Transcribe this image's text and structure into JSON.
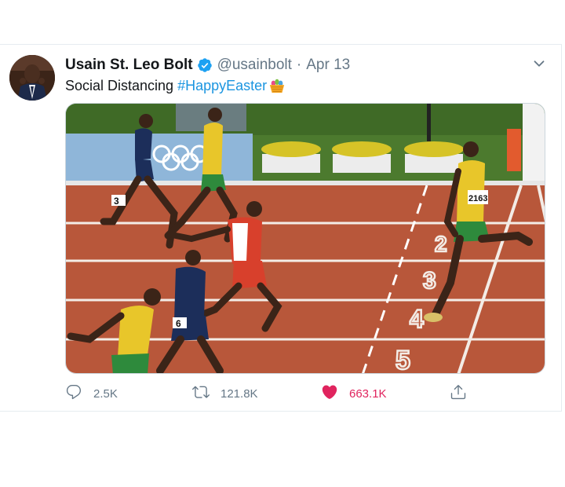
{
  "tweet": {
    "author_name": "Usain St. Leo Bolt",
    "handle": "@usainbolt",
    "separator": "·",
    "date": "Apr 13",
    "text": "Social Distancing",
    "hashtag": "#HappyEaster",
    "emoji": "easter-basket-emoji"
  },
  "actions": {
    "replies": "2.5K",
    "retweets": "121.8K",
    "likes": "663.1K"
  },
  "image": {
    "lane_numbers": [
      "2",
      "3",
      "4",
      "5"
    ],
    "bib_numbers": [
      "3",
      "6",
      "2163"
    ]
  },
  "colors": {
    "verified_blue": "#1da1f2",
    "hashtag_blue": "#1b95e0",
    "like_pink": "#e0245e",
    "muted_gray": "#657786",
    "track_red": "#b8573a",
    "infield_green": "#4c7a2e"
  },
  "icons": [
    "chevron-down-icon",
    "verified-badge-icon",
    "reply-icon",
    "retweet-icon",
    "heart-icon",
    "share-icon"
  ]
}
